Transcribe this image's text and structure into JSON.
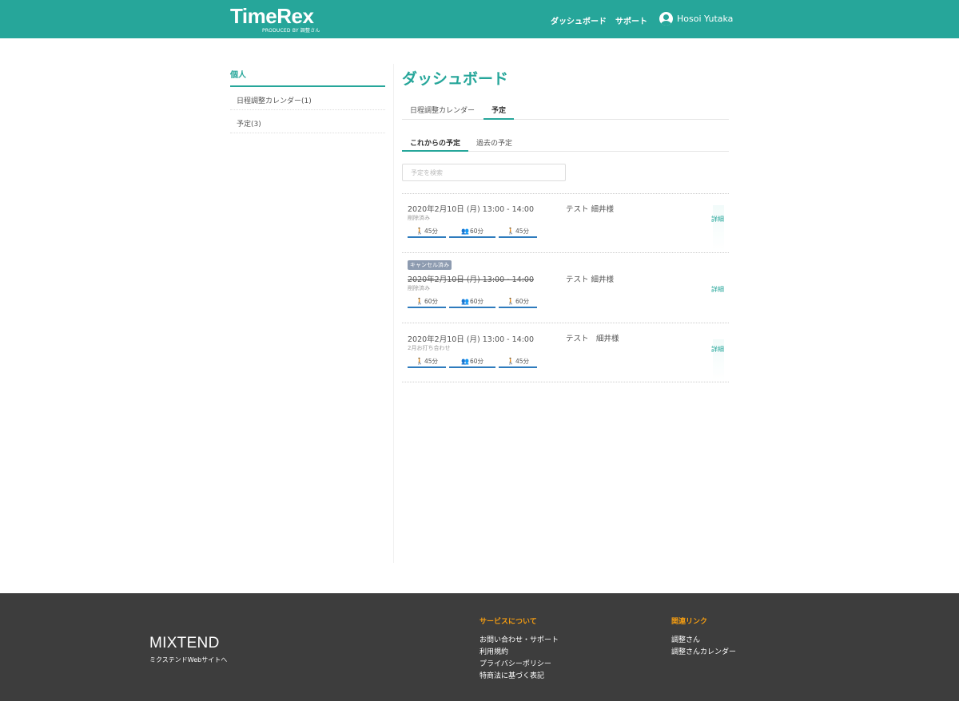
{
  "header": {
    "logo": "TimeRex",
    "logo_sub": "PRODUCED BY 調整さん",
    "nav": [
      "ダッシュボード",
      "サポート"
    ],
    "user_name": "Hosoi Yutaka"
  },
  "sidebar": {
    "title": "個人",
    "items": [
      "日程調整カレンダー(1)",
      "予定(3)"
    ]
  },
  "main": {
    "title": "ダッシュボード",
    "tabs": [
      "日程調整カレンダー",
      "予定"
    ],
    "active_tab": "予定",
    "subtabs": [
      "これからの予定",
      "過去の予定"
    ],
    "active_subtab": "これからの予定",
    "search_placeholder": "予定を検索",
    "events": [
      {
        "date": "2020年2月10日 (月) 13:00 - 14:00",
        "status": "削除済み",
        "title": "テスト 細井様",
        "detail": "詳細",
        "cancelled": false,
        "bars": [
          {
            "icon": "walking-person-icon",
            "label": "45分"
          },
          {
            "icon": "meeting-people-icon",
            "label": "60分"
          },
          {
            "icon": "walking-person-icon",
            "label": "45分"
          }
        ]
      },
      {
        "badge": "キャンセル済み",
        "date": "2020年2月10日 (月) 13:00 - 14:00",
        "status": "削除済み",
        "title": "テスト 細井様",
        "detail": "詳細",
        "cancelled": true,
        "bars": [
          {
            "icon": "walking-person-icon",
            "label": "60分"
          },
          {
            "icon": "meeting-people-icon",
            "label": "60分"
          },
          {
            "icon": "walking-person-icon",
            "label": "60分"
          }
        ]
      },
      {
        "date": "2020年2月10日 (月) 13:00 - 14:00",
        "status": "2月お打ち合わせ",
        "title": "テスト　細井様",
        "detail": "詳細",
        "cancelled": false,
        "bars": [
          {
            "icon": "walking-person-icon",
            "label": "45分"
          },
          {
            "icon": "meeting-people-icon",
            "label": "60分"
          },
          {
            "icon": "walking-person-icon",
            "label": "45分"
          }
        ]
      }
    ]
  },
  "footer": {
    "brand": "MIXTEND",
    "brand_link": "ミクステンドWebサイトへ",
    "col1_title": "サービスについて",
    "col1_links": [
      "お問い合わせ・サポート",
      "利用規約",
      "プライバシーポリシー",
      "特商法に基づく表記"
    ],
    "col2_title": "関連リンク",
    "col2_links": [
      "調整さん",
      "調整さんカレンダー"
    ]
  },
  "colors": {
    "primary": "#26a69a",
    "bar_underline": "#2e7bbd",
    "footer_bg": "#3d3d3d",
    "footer_heading": "#f39c12",
    "badge": "#8d9bb0"
  }
}
